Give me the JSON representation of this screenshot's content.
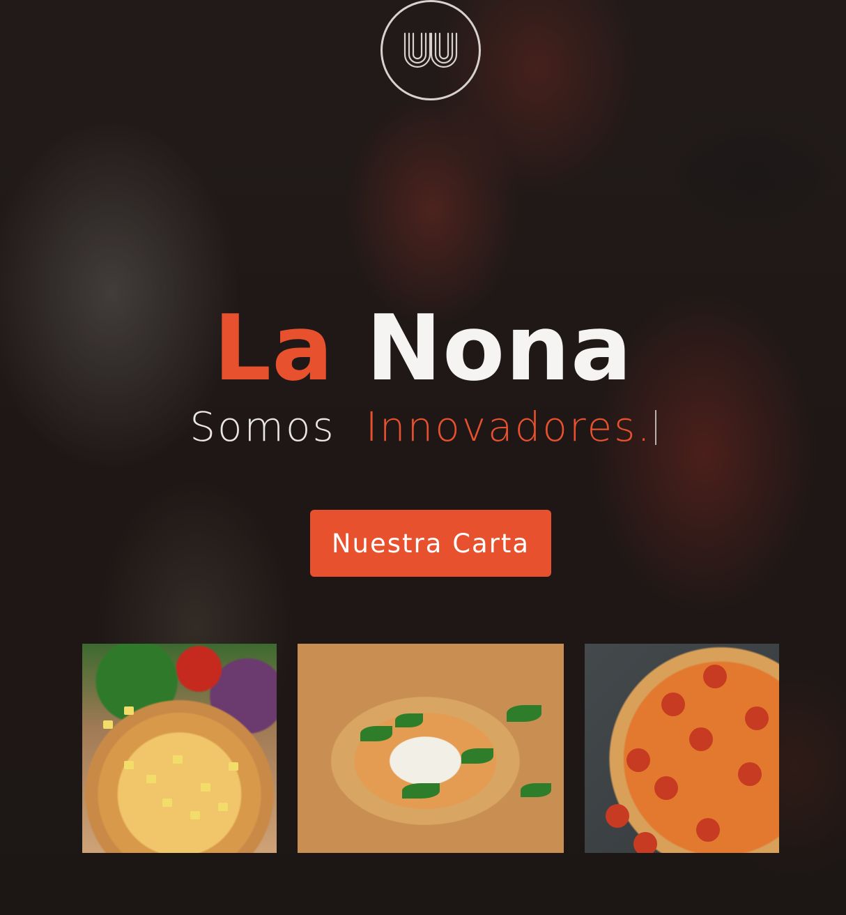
{
  "brand": {
    "logo_icon": "w-monogram-circle-icon"
  },
  "hero": {
    "title_part1": "La",
    "title_part2": "Nona",
    "tagline_prefix": "Somos",
    "tagline_highlight": "Innovadores."
  },
  "cta": {
    "label": "Nuestra Carta"
  },
  "gallery": {
    "images": [
      {
        "name": "hawaiian-pizza-image"
      },
      {
        "name": "margherita-pizza-image"
      },
      {
        "name": "pepperoni-pizza-image"
      }
    ]
  },
  "colors": {
    "accent": "#e8512e",
    "text_light": "#f5f4f3"
  }
}
